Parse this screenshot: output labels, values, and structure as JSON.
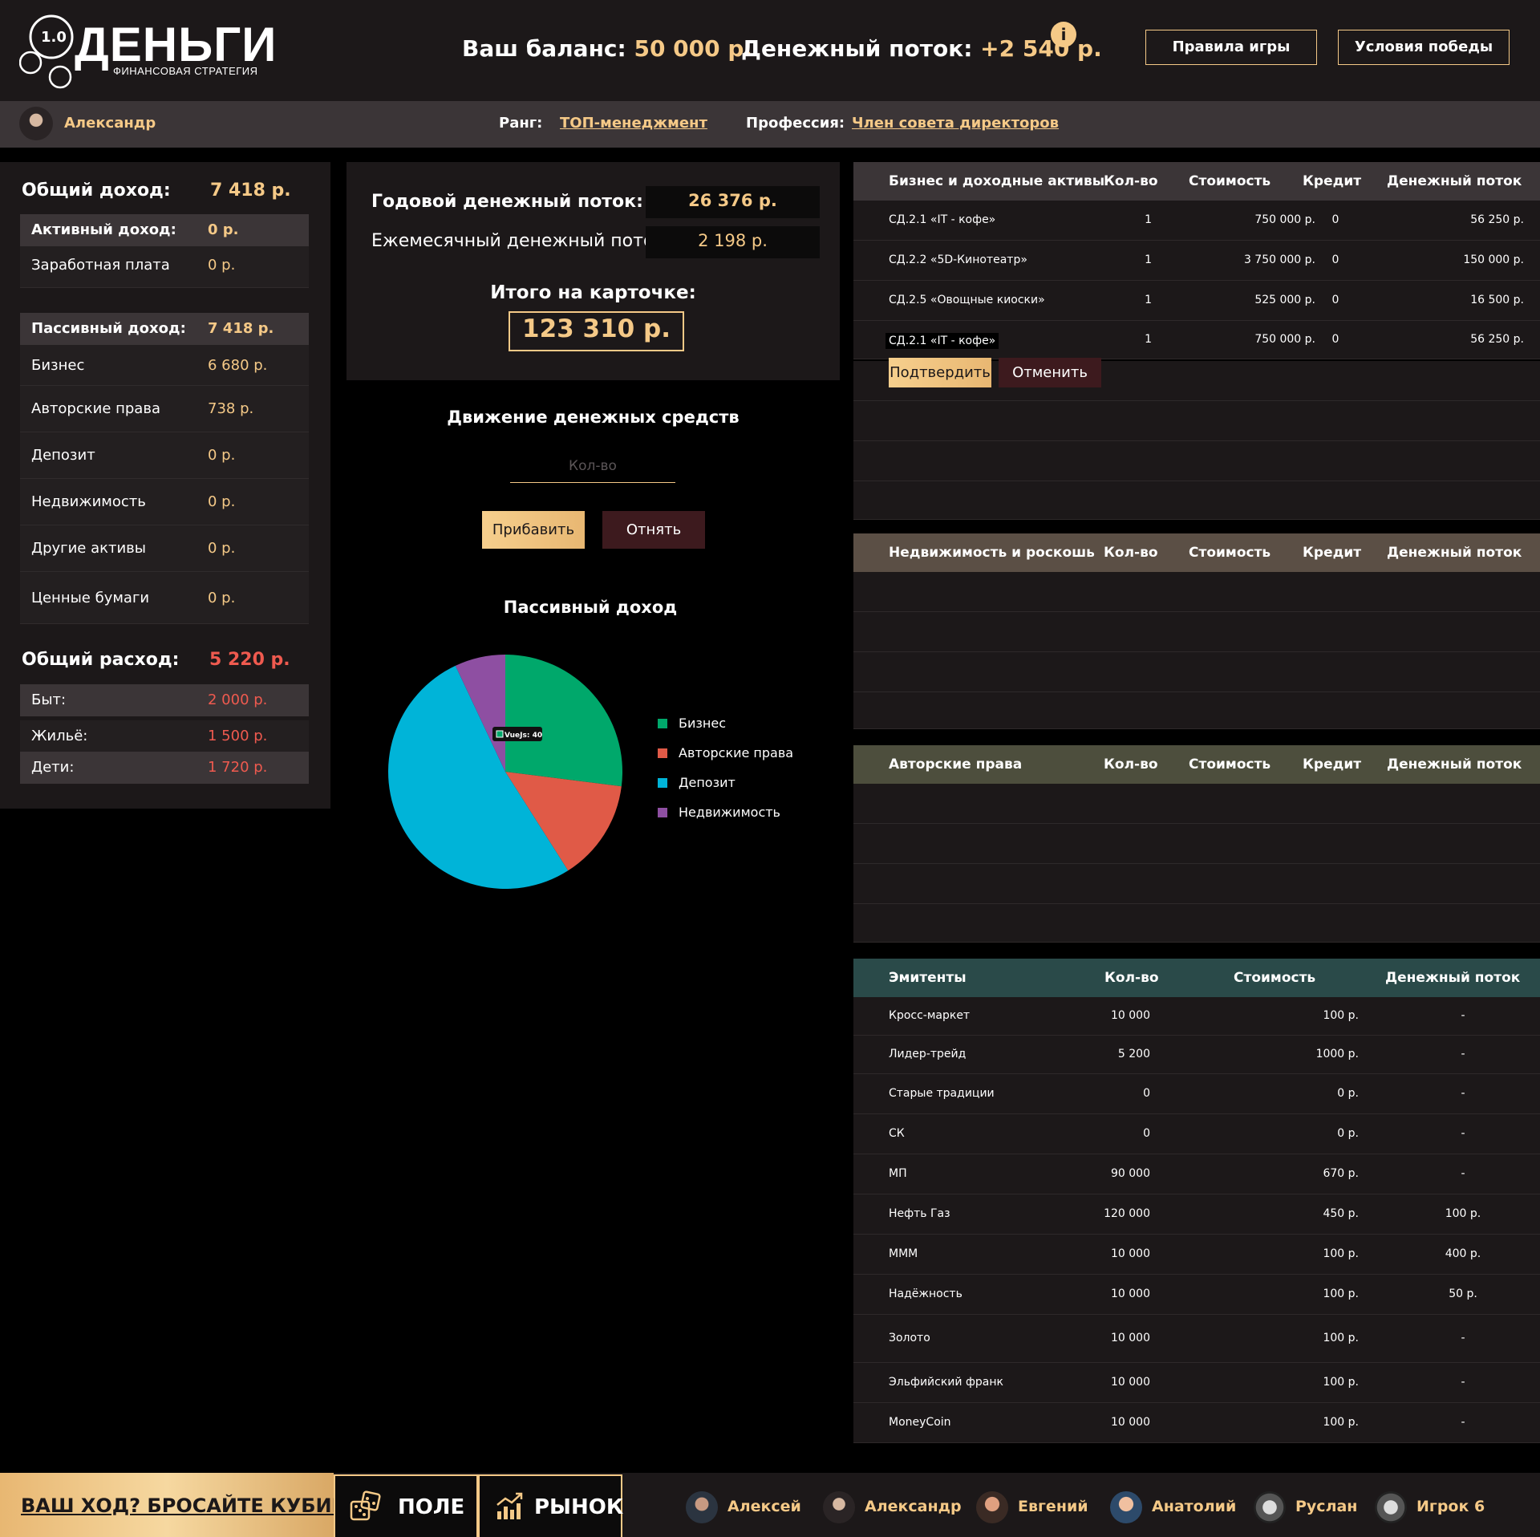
{
  "header": {
    "logo_version": "1.0",
    "logo_title": "ДЕНЬГИ",
    "logo_subtitle": "ФИНАНСОВАЯ СТРАТЕГИЯ",
    "balance_label": "Ваш баланс:",
    "balance_value": "50 000 р.",
    "flow_label": "Денежный поток:",
    "flow_value": "+2 540 р.",
    "info_icon": "info-icon",
    "rules_button": "Правила игры",
    "win_button": "Условия победы"
  },
  "player": {
    "name": "Александр",
    "rank_label": "Ранг:",
    "rank_value": "ТОП-менеджмент",
    "profession_label": "Профессия:",
    "profession_value": "Член совета директоров"
  },
  "income": {
    "total_label": "Общий доход:",
    "total_value": "7 418 р.",
    "active_label": "Активный доход:",
    "active_value": "0 р.",
    "active_items": [
      {
        "label": "Заработная плата",
        "value": "0 р."
      }
    ],
    "passive_label": "Пассивный доход:",
    "passive_value": "7 418 р.",
    "passive_items": [
      {
        "label": "Бизнес",
        "value": "6 680 р."
      },
      {
        "label": "Авторские права",
        "value": "738 р."
      },
      {
        "label": "Депозит",
        "value": "0 р."
      },
      {
        "label": "Недвижимость",
        "value": "0 р."
      },
      {
        "label": "Другие активы",
        "value": "0 р."
      },
      {
        "label": "Ценные бумаги",
        "value": "0 р."
      }
    ]
  },
  "expenses": {
    "total_label": "Общий расход:",
    "total_value": "5 220 р.",
    "items": [
      {
        "label": "Быт:",
        "value": "2 000 р."
      },
      {
        "label": "Жильё:",
        "value": "1 500 р."
      },
      {
        "label": "Дети:",
        "value": "1 720 р."
      }
    ]
  },
  "summary": {
    "yearly_label": "Годовой денежный поток:",
    "yearly_value": "26 376 р.",
    "monthly_label": "Ежемесячный денежный поток:",
    "monthly_value": "2 198 р.",
    "total_label": "Итого на карточке:",
    "total_value": "123 310 р."
  },
  "cash": {
    "title": "Движение денежных средств",
    "qty_placeholder": "Кол-во",
    "add_button": "Прибавить",
    "subtract_button": "Отнять"
  },
  "chart_data": {
    "type": "pie",
    "title": "Пассивный доход",
    "categories": [
      "Бизнес",
      "Авторские права",
      "Депозит",
      "Недвижимость"
    ],
    "values": [
      27,
      14,
      52,
      7
    ],
    "colors": [
      "#00a86b",
      "#e05a47",
      "#00b4d8",
      "#8e4fa2"
    ],
    "legend_position": "right",
    "tooltip": "VueJs: 40"
  },
  "business": {
    "headers": [
      "Бизнес и доходные активы",
      "Кол-во",
      "Стоимость",
      "Кредит",
      "Денежный поток"
    ],
    "header_color": "#3b3537",
    "rows": [
      {
        "name": "СД.2.1 «IT - кофе»",
        "qty": "1",
        "cost": "750 000 р.",
        "credit": "0",
        "flow": "56 250 р."
      },
      {
        "name": "СД.2.2 «5D-Кинотеатр»",
        "qty": "1",
        "cost": "3 750 000 р.",
        "credit": "0",
        "flow": "150 000 р."
      },
      {
        "name": "СД.2.5 «Овощные киоски»",
        "qty": "1",
        "cost": "525 000 р.",
        "credit": "0",
        "flow": "16 500 р."
      },
      {
        "name": "СД.2.1 «IT - кофе»",
        "qty": "1",
        "cost": "750 000 р.",
        "credit": "0",
        "flow": "56 250 р."
      }
    ],
    "confirm_button": "Подтвердить",
    "cancel_button": "Отменить"
  },
  "realty": {
    "headers": [
      "Недвижимость и роскошь",
      "Кол-во",
      "Стоимость",
      "Кредит",
      "Денежный поток"
    ],
    "header_color": "#5b4f45"
  },
  "copyrights": {
    "headers": [
      "Авторские права",
      "Кол-во",
      "Стоимость",
      "Кредит",
      "Денежный поток"
    ],
    "header_color": "#4d4e3d"
  },
  "emitters": {
    "headers": [
      "Эмитенты",
      "Кол-во",
      "Стоимость",
      "Денежный поток"
    ],
    "header_color": "#2a4a49",
    "rows": [
      {
        "name": "Кросс-маркет",
        "qty": "10 000",
        "cost": "100 р.",
        "flow": "-"
      },
      {
        "name": "Лидер-трейд",
        "qty": "5 200",
        "cost": "1000 р.",
        "flow": "-"
      },
      {
        "name": "Старые традиции",
        "qty": "0",
        "cost": "0 р.",
        "flow": "-"
      },
      {
        "name": "СК",
        "qty": "0",
        "cost": "0 р.",
        "flow": "-"
      },
      {
        "name": "МП",
        "qty": "90 000",
        "cost": "670 р.",
        "flow": "-"
      },
      {
        "name": "Нефть Газ",
        "qty": "120 000",
        "cost": "450 р.",
        "flow": "100 р."
      },
      {
        "name": "МММ",
        "qty": "10 000",
        "cost": "100 р.",
        "flow": "400 р."
      },
      {
        "name": "Надёжность",
        "qty": "10 000",
        "cost": "100 р.",
        "flow": "50 р."
      },
      {
        "name": "Золото",
        "qty": "10 000",
        "cost": "100 р.",
        "flow": "-"
      },
      {
        "name": "Эльфийский франк",
        "qty": "10 000",
        "cost": "100 р.",
        "flow": "-"
      },
      {
        "name": "MoneyCoin",
        "qty": "10 000",
        "cost": "100 р.",
        "flow": "-"
      }
    ]
  },
  "footer": {
    "dice_label": "ВАШ ХОД? БРОСАЙТЕ КУБИКИ!",
    "field_label": "ПОЛЕ",
    "market_label": "РЫНОК",
    "players": [
      "Алексей",
      "Александр",
      "Евгений",
      "Анатолий",
      "Руслан",
      "Игрок 6"
    ]
  }
}
